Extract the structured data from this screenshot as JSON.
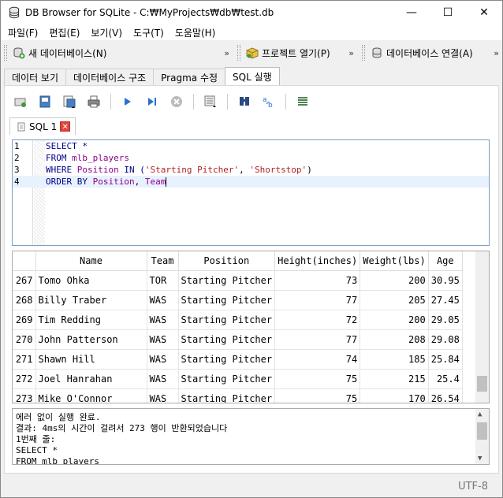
{
  "window": {
    "title": "DB Browser for SQLite - C:₩MyProjects₩db₩test.db",
    "minimize": "—",
    "maximize": "☐",
    "close": "✕"
  },
  "menu": [
    "파일(F)",
    "편집(E)",
    "보기(V)",
    "도구(T)",
    "도움말(H)"
  ],
  "toolbar": {
    "new_db": "새 데이터베이스(N)",
    "open_project": "프로젝트 열기(P)",
    "connect_db": "데이터베이스 연결(A)",
    "overflow": "»"
  },
  "tabs": [
    "데이터 보기",
    "데이터베이스 구조",
    "Pragma 수정",
    "SQL 실행"
  ],
  "active_tab": "SQL 실행",
  "sql_tab": {
    "label": "SQL 1"
  },
  "editor": {
    "lines": [
      {
        "n": "1",
        "parts": [
          {
            "t": "SELECT *",
            "c": "kw"
          }
        ]
      },
      {
        "n": "2",
        "parts": [
          {
            "t": "FROM ",
            "c": "kw"
          },
          {
            "t": "mlb_players",
            "c": "id"
          }
        ]
      },
      {
        "n": "3",
        "parts": [
          {
            "t": "WHERE ",
            "c": "kw"
          },
          {
            "t": "Position",
            "c": "id"
          },
          {
            "t": " IN (",
            "c": "kw"
          },
          {
            "t": "'Starting Pitcher'",
            "c": "str"
          },
          {
            "t": ", ",
            "c": ""
          },
          {
            "t": "'Shortstop'",
            "c": "str"
          },
          {
            "t": ")",
            "c": ""
          }
        ]
      },
      {
        "n": "4",
        "parts": [
          {
            "t": "ORDER BY ",
            "c": "kw"
          },
          {
            "t": "Position",
            "c": "id"
          },
          {
            "t": ", ",
            "c": ""
          },
          {
            "t": "Team",
            "c": "id"
          }
        ]
      }
    ]
  },
  "grid": {
    "columns": [
      "Name",
      "Team",
      "Position",
      "Height(inches)",
      "Weight(lbs)",
      "Age"
    ],
    "rows": [
      {
        "num": "267",
        "cells": [
          "Tomo Ohka",
          "TOR",
          "Starting Pitcher",
          "73",
          "200",
          "30.95"
        ]
      },
      {
        "num": "268",
        "cells": [
          "Billy Traber",
          "WAS",
          "Starting Pitcher",
          "77",
          "205",
          "27.45"
        ]
      },
      {
        "num": "269",
        "cells": [
          "Tim Redding",
          "WAS",
          "Starting Pitcher",
          "72",
          "200",
          "29.05"
        ]
      },
      {
        "num": "270",
        "cells": [
          "John Patterson",
          "WAS",
          "Starting Pitcher",
          "77",
          "208",
          "29.08"
        ]
      },
      {
        "num": "271",
        "cells": [
          "Shawn Hill",
          "WAS",
          "Starting Pitcher",
          "74",
          "185",
          "25.84"
        ]
      },
      {
        "num": "272",
        "cells": [
          "Joel Hanrahan",
          "WAS",
          "Starting Pitcher",
          "75",
          "215",
          "25.4"
        ]
      },
      {
        "num": "273",
        "cells": [
          "Mike O'Connor",
          "WAS",
          "Starting Pitcher",
          "75",
          "170",
          "26.54"
        ]
      }
    ]
  },
  "messages": [
    "에러 없이 실행 완료.",
    "결과: 4ms의 시간이 걸려서 273 행이 반환되었습니다",
    "1번째 줄:",
    "SELECT *",
    "FROM mlb_players"
  ],
  "status": {
    "encoding": "UTF-8"
  }
}
